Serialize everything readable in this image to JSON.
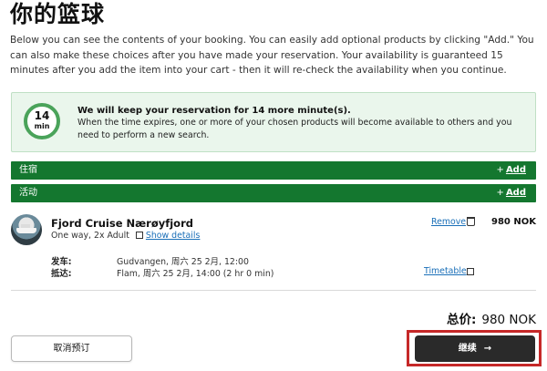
{
  "page": {
    "title": "你的篮球",
    "intro": "Below you can see the contents of your booking. You can easily add optional products by clicking \"Add.\" You can also make these choices after you have made your reservation. Your availability is guaranteed 15 minutes after you add the item into your cart - then it will re-check the availability when you continue."
  },
  "timer": {
    "minutes": "14",
    "unit": "min",
    "heading": "We will keep your reservation for 14 more minute(s).",
    "text": "When the time expires, one or more of your chosen products will become available to others and you need to perform a new search."
  },
  "sections": [
    {
      "label": "住宿",
      "add_label": "Add",
      "add_icon": "+"
    },
    {
      "label": "活动",
      "add_label": "Add",
      "add_icon": "+"
    }
  ],
  "product": {
    "name": "Fjord Cruise Nærøyfjord",
    "subtitle": "One way, 2x Adult",
    "show_details": "Show details",
    "remove": "Remove",
    "price": "980 NOK",
    "departure_label": "发车:",
    "departure_value": "Gudvangen, 周六 25 2月, 12:00",
    "arrival_label": "抵达:",
    "arrival_value": "Flam, 周六 25 2月, 14:00 (2 hr 0 min)",
    "timetable": "Timetable"
  },
  "total": {
    "label": "总价:",
    "value": "980 NOK"
  },
  "actions": {
    "cancel": "取消预订",
    "continue": "继续",
    "continue_arrow": "→"
  },
  "colors": {
    "brand_green": "#14772f",
    "timer_bg": "#eaf6ec",
    "link": "#1a6fb8",
    "continue_bg": "#2a2a2a",
    "highlight": "#c62828"
  }
}
